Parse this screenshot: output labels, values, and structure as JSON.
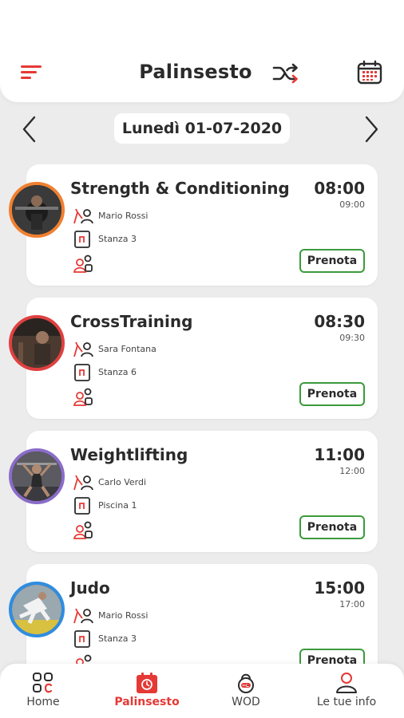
{
  "header": {
    "title": "Palinsesto"
  },
  "date_nav": {
    "current_date": "Lunedì 01-07-2020"
  },
  "colors": {
    "accent": "#e53935",
    "book_border": "#3c9a3c",
    "background": "#ececec"
  },
  "classes": [
    {
      "name": "Strength & Conditioning",
      "start": "08:00",
      "end": "09:00",
      "instructor": "Mario Rossi",
      "room": "Stanza 3",
      "book_label": "Prenota",
      "ring_color": "#f08030"
    },
    {
      "name": "CrossTraining",
      "start": "08:30",
      "end": "09:30",
      "instructor": "Sara Fontana",
      "room": "Stanza 6",
      "book_label": "Prenota",
      "ring_color": "#e04040"
    },
    {
      "name": "Weightlifting",
      "start": "11:00",
      "end": "12:00",
      "instructor": "Carlo Verdi",
      "room": "Piscina 1",
      "book_label": "Prenota",
      "ring_color": "#8a6cc8"
    },
    {
      "name": "Judo",
      "start": "15:00",
      "end": "17:00",
      "instructor": "Mario Rossi",
      "room": "Stanza 3",
      "book_label": "Prenota",
      "ring_color": "#2f8de0"
    }
  ],
  "nav": {
    "items": [
      {
        "label": "Home",
        "icon": "grid-icon",
        "active": false
      },
      {
        "label": "Palinsesto",
        "icon": "calendar-icon",
        "active": true
      },
      {
        "label": "WOD",
        "icon": "kettlebell-icon",
        "active": false
      },
      {
        "label": "Le tue info",
        "icon": "user-icon",
        "active": false
      }
    ]
  }
}
